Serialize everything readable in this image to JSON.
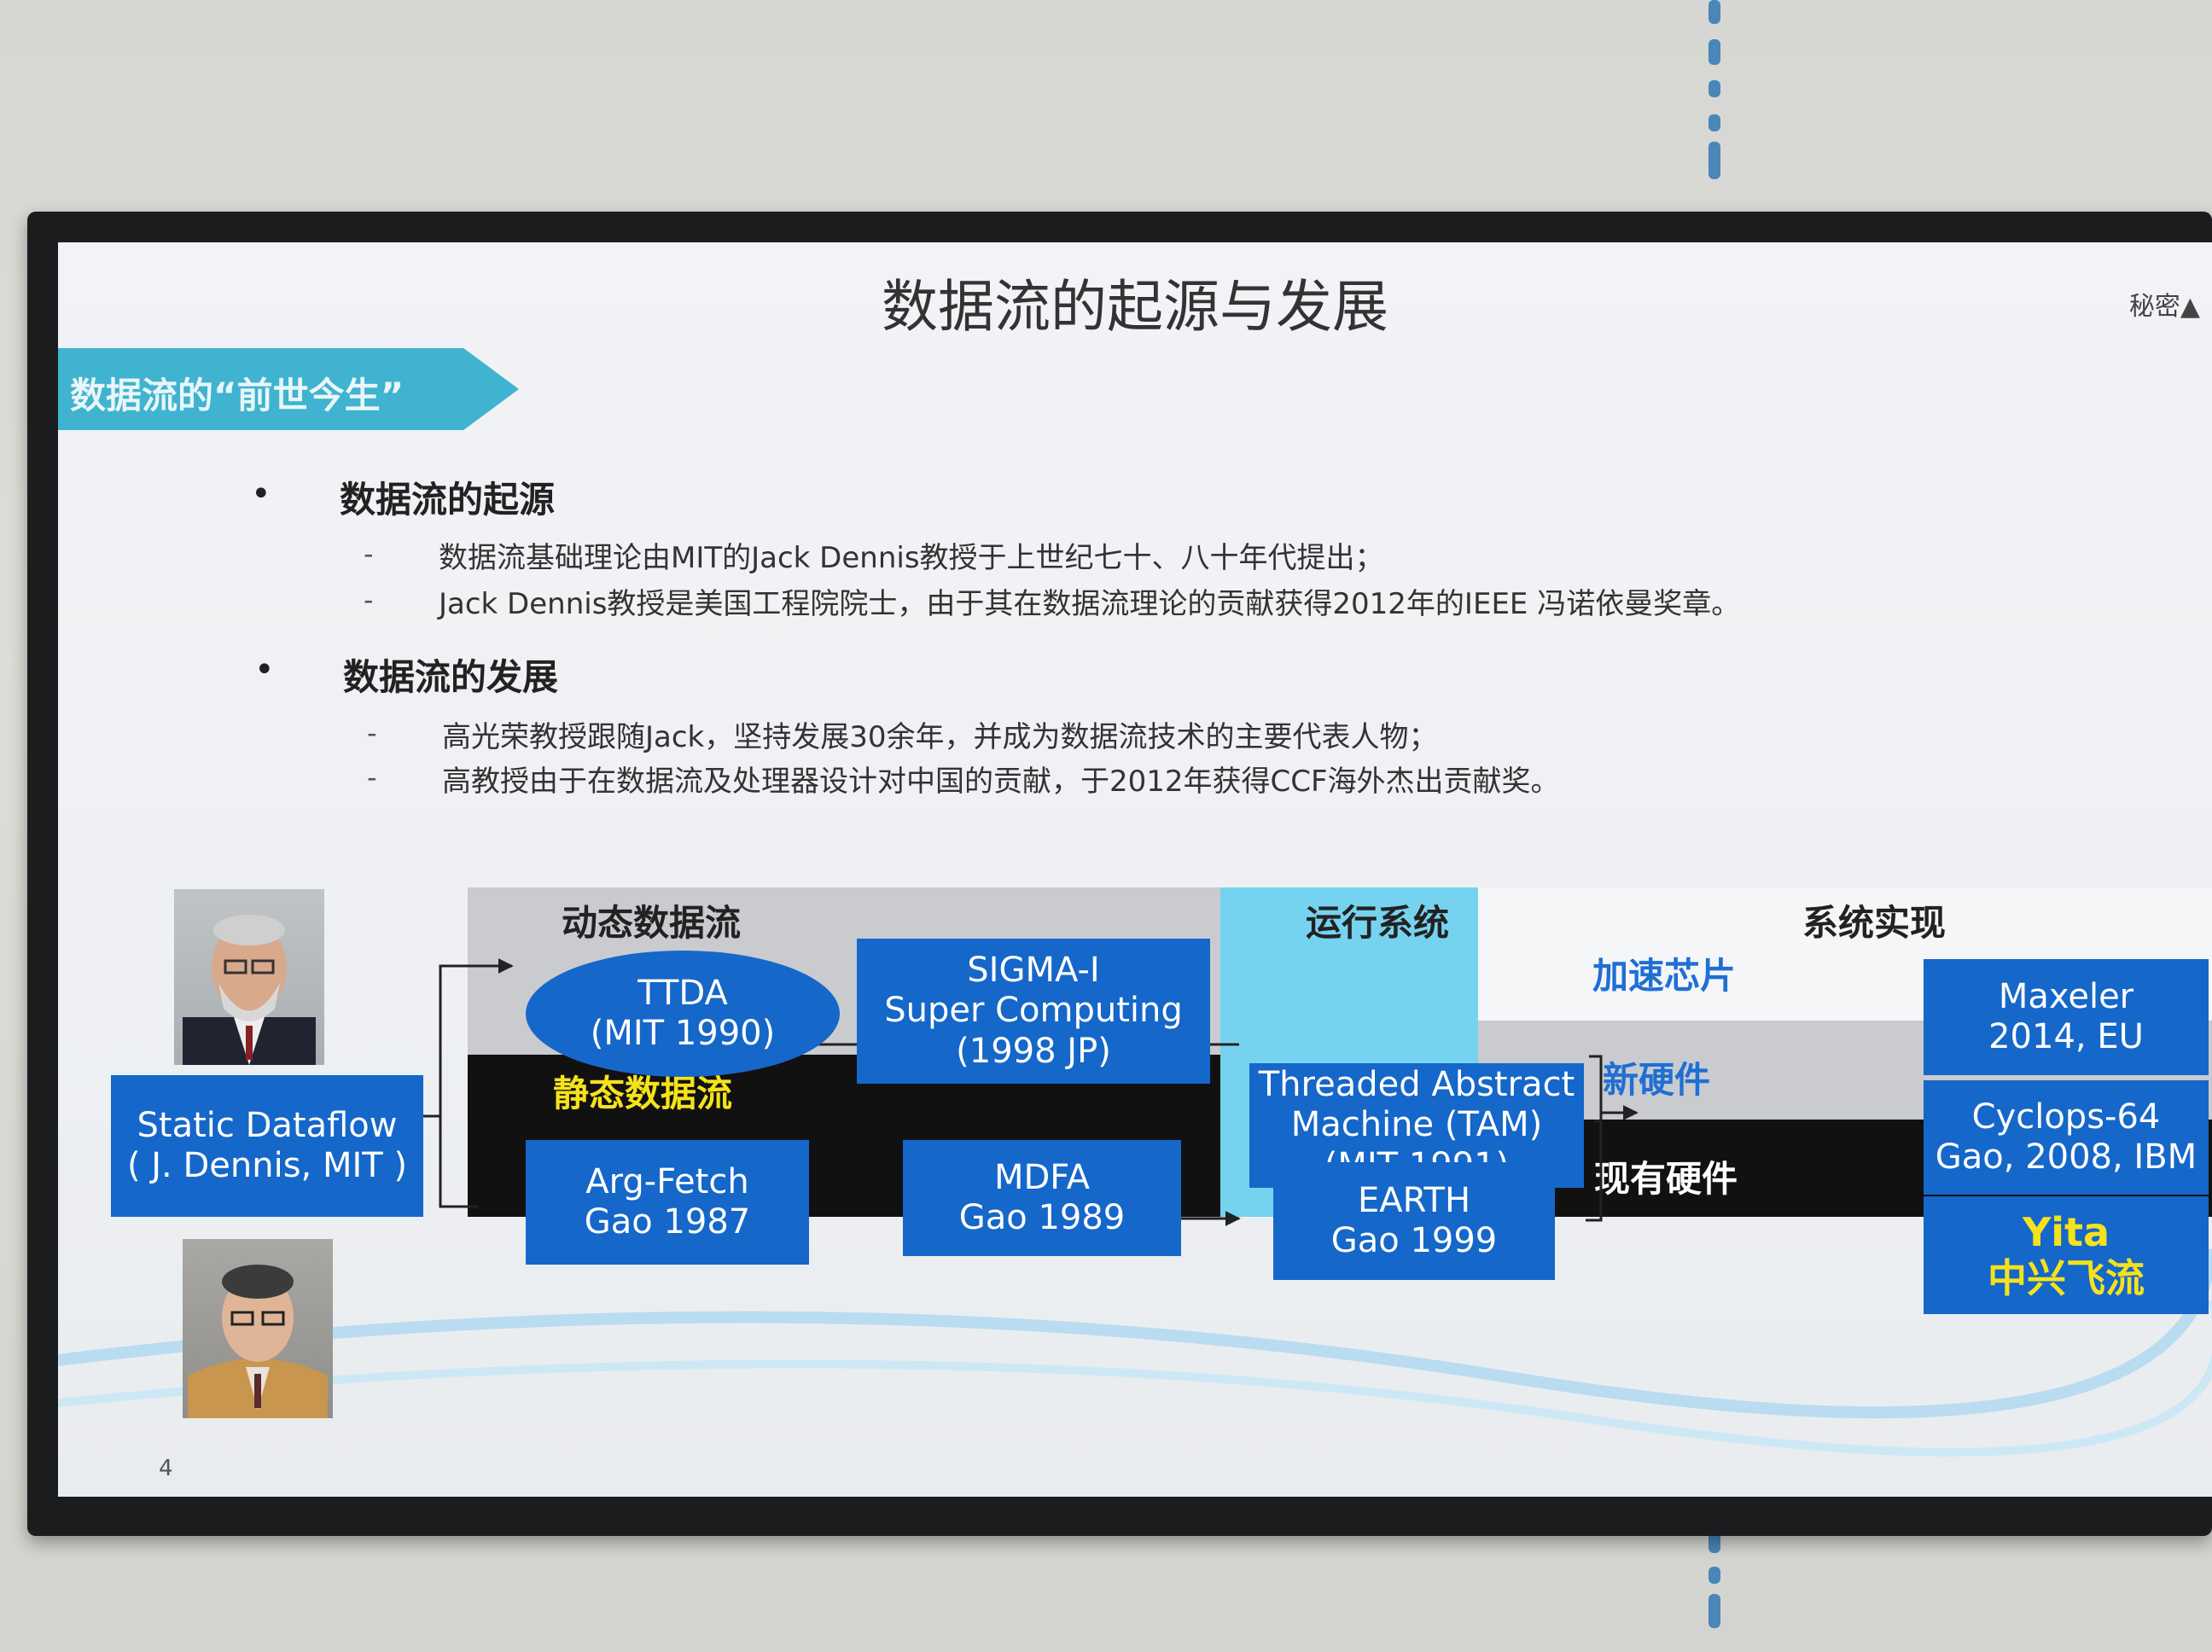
{
  "slide": {
    "title": "数据流的起源与发展",
    "classification": "秘密▲",
    "banner": "数据流的“前世今生”",
    "page_number": "4",
    "sections": [
      {
        "heading": "数据流的起源",
        "items": [
          "数据流基础理论由MIT的Jack Dennis教授于上世纪七十、八十年代提出；",
          "Jack Dennis教授是美国工程院院士，由于其在数据流理论的贡献获得2012年的IEEE 冯诺依曼奖章。"
        ]
      },
      {
        "heading": "数据流的发展",
        "items": [
          "高光荣教授跟随Jack，坚持发展30余年，并成为数据流技术的主要代表人物；",
          "高教授由于在数据流及处理器设计对中国的贡献，于2012年获得CCF海外杰出贡献奖。"
        ]
      }
    ],
    "bullet_symbol": "•",
    "dash_symbol": "-"
  },
  "diagram": {
    "static_dataflow": [
      "Static Dataflow",
      "( J. Dennis, MIT )"
    ],
    "dynamic_label": "动态数据流",
    "static_label": "静态数据流",
    "runtime_label": "运行系统",
    "system_label": "系统实现",
    "ttda": [
      "TTDA",
      "(MIT 1990)"
    ],
    "sigma": [
      "SIGMA-I",
      "Super Computing",
      "(1998 JP)"
    ],
    "argfetch": [
      "Arg-Fetch",
      "Gao 1987"
    ],
    "mdfa": [
      "MDFA",
      "Gao 1989"
    ],
    "tam": [
      "Threaded Abstract",
      "Machine (TAM)",
      "(MIT 1991)"
    ],
    "earth": [
      "EARTH",
      "Gao 1999"
    ],
    "accel_label": "加速芯片",
    "new_hw_label": "新硬件",
    "existing_hw_label": "现有硬件",
    "maxeler": [
      "Maxeler",
      "2014, EU"
    ],
    "cyclops": [
      "Cyclops-64",
      "Gao, 2008, IBM"
    ],
    "yita": [
      "Yita",
      "中兴飞流"
    ]
  },
  "colors": {
    "box_blue": "#1567c9",
    "banner_teal": "#3fb3cf",
    "runtime_cyan": "#76d3f0",
    "label_blue": "#1f6fd4",
    "yellow": "#f5e21b"
  }
}
